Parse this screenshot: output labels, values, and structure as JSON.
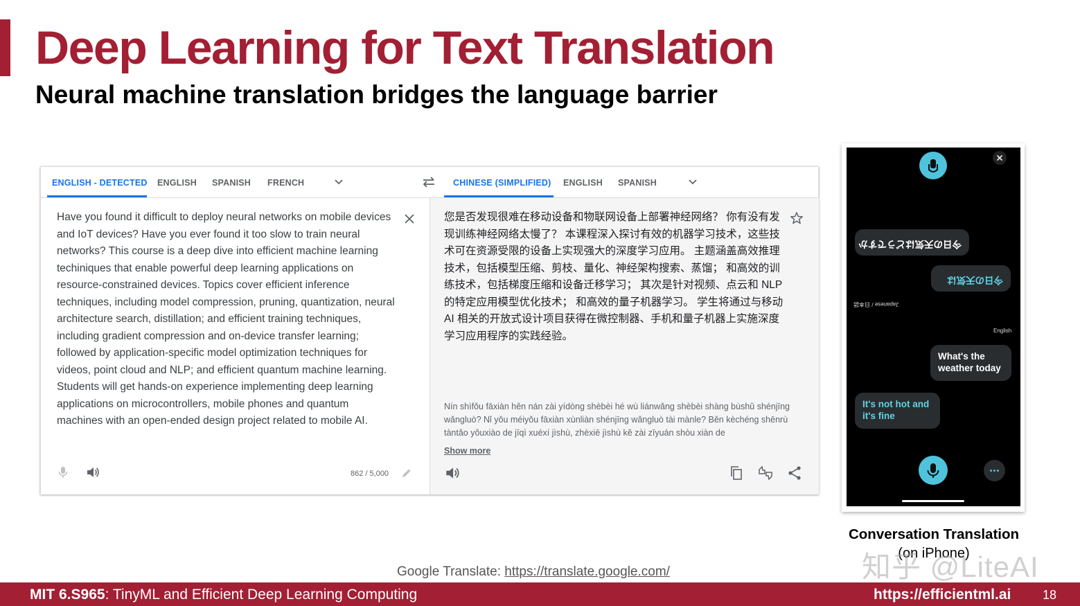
{
  "slide": {
    "title": "Deep Learning for Text Translation",
    "subtitle": "Neural machine translation bridges the language barrier"
  },
  "translate": {
    "source_tabs": [
      "ENGLISH - DETECTED",
      "ENGLISH",
      "SPANISH",
      "FRENCH"
    ],
    "target_tabs": [
      "CHINESE (SIMPLIFIED)",
      "ENGLISH",
      "SPANISH"
    ],
    "source_text": "Have you found it difficult to deploy neural networks on mobile devices and IoT devices? Have you ever found it too slow to train neural networks? This course is a deep dive into efficient machine learning techiniques that enable powerful deep learning applications on resource-constrained devices. Topics cover efficient inference techniques, including model compression, pruning, quantization, neural architecture search, distillation; and efficient training techniques, including gradient compression and on-device transfer learning; followed by application-specific model optimization techniques for videos, point cloud and NLP; and efficient quantum machine learning. Students will get hands-on experience implementing deep learning applications on microcontrollers, mobile phones and quantum machines with an open-ended design project related to mobile AI.",
    "char_count": "862 / 5,000",
    "target_text": "您是否发现很难在移动设备和物联网设备上部署神经网络？ 你有没有发现训练神经网络太慢了？ 本课程深入探讨有效的机器学习技术，这些技术可在资源受限的设备上实现强大的深度学习应用。 主题涵盖高效推理技术，包括模型压缩、剪枝、量化、神经架构搜索、蒸馏； 和高效的训练技术，包括梯度压缩和设备迁移学习； 其次是针对视频、点云和 NLP 的特定应用模型优化技术； 和高效的量子机器学习。 学生将通过与移动 AI 相关的开放式设计项目获得在微控制器、手机和量子机器上实施深度学习应用程序的实践经验。",
    "pinyin": "Nín shìfǒu fāxiàn hěn nán zài yídòng shèbèi hé wù liánwǎng shèbèi shàng bùshǔ shénjīng wǎngluò? Nǐ yǒu méiyǒu fāxiàn xùnliàn shénjīng wǎngluò tài mànle? Běn kèchéng shēnrù tàntǎo yǒuxiào de jīqì xuéxí jìshù, zhèxiē jìshù kě zài zīyuán shòu xiàn de",
    "show_more": "Show more",
    "icons": [
      "swap-icon",
      "close-icon",
      "mic-icon",
      "speaker-icon",
      "pencil-icon",
      "star-icon",
      "copy-icon",
      "feedback-icon",
      "share-icon",
      "chevron-down-icon"
    ]
  },
  "phone": {
    "bubble_flipped_1": "今日の天気はどうですか",
    "bubble_flipped_2": "今日の天気は",
    "label_japanese": "Japanese / 日本語",
    "label_english": "English",
    "bubble_question": "What's the weather today",
    "bubble_answer": "It's not hot and it's fine",
    "caption": "Conversation Translation",
    "caption_sub": "(on iPhone)"
  },
  "watermark": "知乎 @LiteAI",
  "source_line": {
    "prefix": "Google Translate: ",
    "url": "https://translate.google.com/"
  },
  "footer": {
    "course_code": "MIT 6.S965",
    "course_name": ": TinyML and Efficient Deep Learning Computing",
    "url": "https://efficientml.ai",
    "page": "18"
  },
  "colors": {
    "brand": "#a31f34",
    "tab_active": "#1a73e8",
    "phone_accent": "#4fc3dc"
  }
}
